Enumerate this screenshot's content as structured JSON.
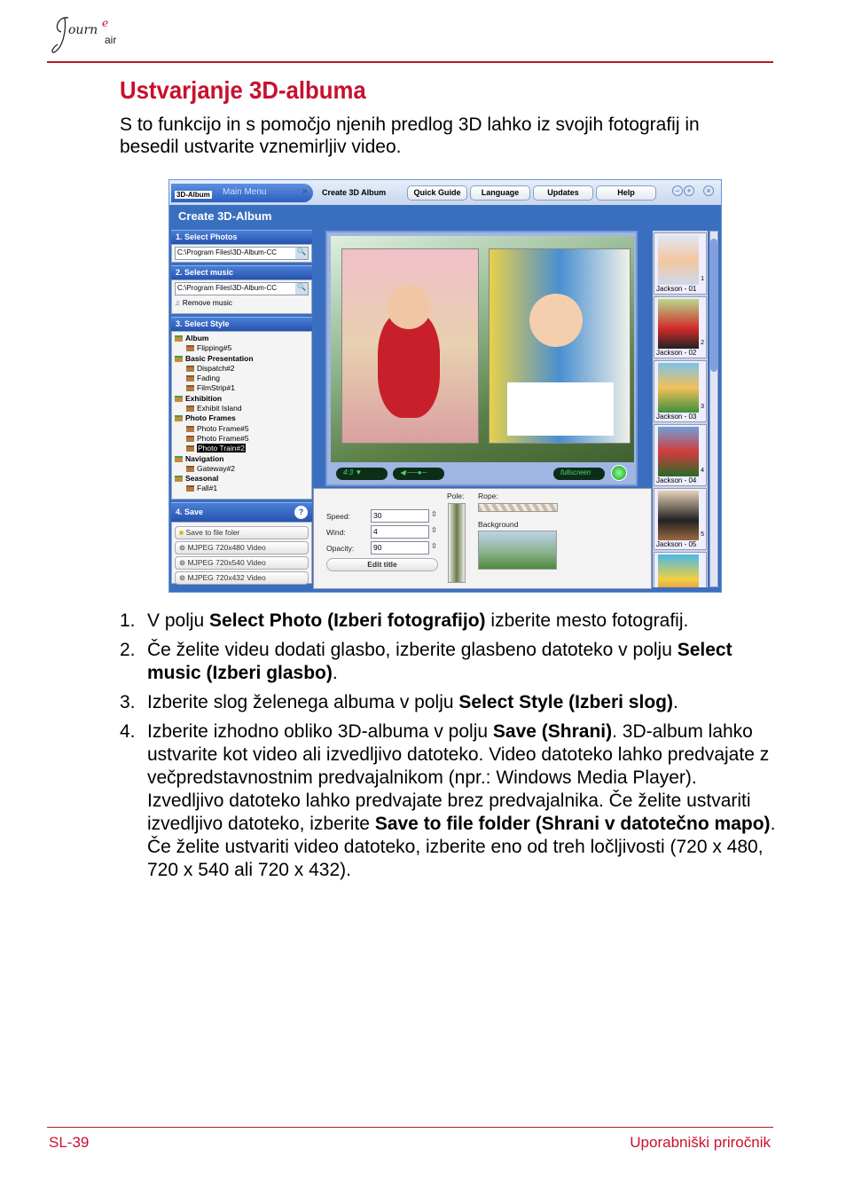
{
  "header": {
    "logo_text": "Journe air"
  },
  "title": "Ustvarjanje 3D-albuma",
  "intro": "S to funkcijo in s pomočjo njenih predlog 3D lahko iz svojih fotografij in besedil ustvarite vznemirljiv video.",
  "app": {
    "logo": "3D-Album",
    "main_menu": "Main Menu",
    "breadcrumb": "Create 3D Album",
    "toolbar": [
      "Quick Guide",
      "Language",
      "Updates",
      "Help"
    ],
    "window_controls": [
      "minimize",
      "maximize",
      "close"
    ],
    "panel_title": "Create 3D-Album",
    "step1": {
      "label": "1. Select Photos",
      "path": "C:\\Program Files\\3D-Album-CC"
    },
    "step2": {
      "label": "2. Select music",
      "path": "C:\\Program Files\\3D-Album-CC",
      "remove": "Remove music"
    },
    "step3": {
      "label": "3. Select Style",
      "tree": [
        {
          "cat": "Album",
          "items": [
            "Flipping#5"
          ]
        },
        {
          "cat": "Basic Presentation",
          "items": [
            "Dispatch#2",
            "Fading",
            "FilmStrip#1"
          ]
        },
        {
          "cat": "Exhibition",
          "items": [
            "Exhibit Island"
          ]
        },
        {
          "cat": "Photo Frames",
          "items": [
            "Photo Frame#5",
            "Photo Frame#5",
            "Photo Train#2"
          ]
        },
        {
          "cat": "Navigation",
          "items": [
            "Gateway#2"
          ]
        },
        {
          "cat": "Seasonal",
          "items": [
            "Fall#1"
          ]
        }
      ],
      "selected": "Photo Train#2"
    },
    "step4": {
      "label": "4. Save",
      "options": [
        "Save to file foler",
        "MJPEG 720x480 Video",
        "MJPEG 720x540 Video",
        "MJPEG 720x432 Video"
      ]
    },
    "preview": {
      "aspect": "4:3",
      "fullscreen": "fullscreen"
    },
    "settings": {
      "speed_label": "Speed:",
      "speed": "30",
      "wind_label": "Wind:",
      "wind": "4",
      "opacity_label": "Opacity:",
      "opacity": "90",
      "edit_title": "Edit title",
      "pole": "Pole:",
      "rope": "Rope:",
      "background": "Background"
    },
    "thumbnails": [
      {
        "name": "Jackson - 01",
        "n": "1"
      },
      {
        "name": "Jackson - 02",
        "n": "2"
      },
      {
        "name": "Jackson - 03",
        "n": "3"
      },
      {
        "name": "Jackson - 04",
        "n": "4"
      },
      {
        "name": "Jackson - 05",
        "n": "5"
      }
    ]
  },
  "steps": [
    {
      "n": "1.",
      "parts": [
        [
          "V polju ",
          0
        ],
        [
          "Select Photo (Izberi fotografijo)",
          1
        ],
        [
          " izberite mesto fotografij.",
          0
        ]
      ]
    },
    {
      "n": "2.",
      "parts": [
        [
          "Če želite videu dodati glasbo, izberite glasbeno datoteko v polju ",
          0
        ],
        [
          "Select music (Izberi glasbo)",
          1
        ],
        [
          ".",
          0
        ]
      ]
    },
    {
      "n": "3.",
      "parts": [
        [
          "Izberite slog želenega albuma v polju ",
          0
        ],
        [
          "Select Style (Izberi slog)",
          1
        ],
        [
          ".",
          0
        ]
      ]
    },
    {
      "n": "4.",
      "parts": [
        [
          "Izberite izhodno obliko 3D-albuma v polju ",
          0
        ],
        [
          "Save (Shrani)",
          1
        ],
        [
          ". 3D-album lahko ustvarite kot video ali izvedljivo datoteko. Video datoteko lahko predvajate z večpredstavnostnim predvajalnikom (npr.: Windows Media Player). Izvedljivo datoteko lahko predvajate brez predvajalnika. Če želite ustvariti izvedljivo datoteko, izberite ",
          0
        ],
        [
          "Save to file folder (Shrani v datotečno mapo)",
          1
        ],
        [
          ". Če želite ustvariti video datoteko, izberite eno od treh ločljivosti (720 x 480, 720 x 540 ali 720 x 432).",
          0
        ]
      ]
    }
  ],
  "footer": {
    "page": "SL-39",
    "manual": "Uporabniški priročnik"
  },
  "colors": {
    "accent": "#c8102e",
    "app_blue": "#3a6fc0"
  }
}
